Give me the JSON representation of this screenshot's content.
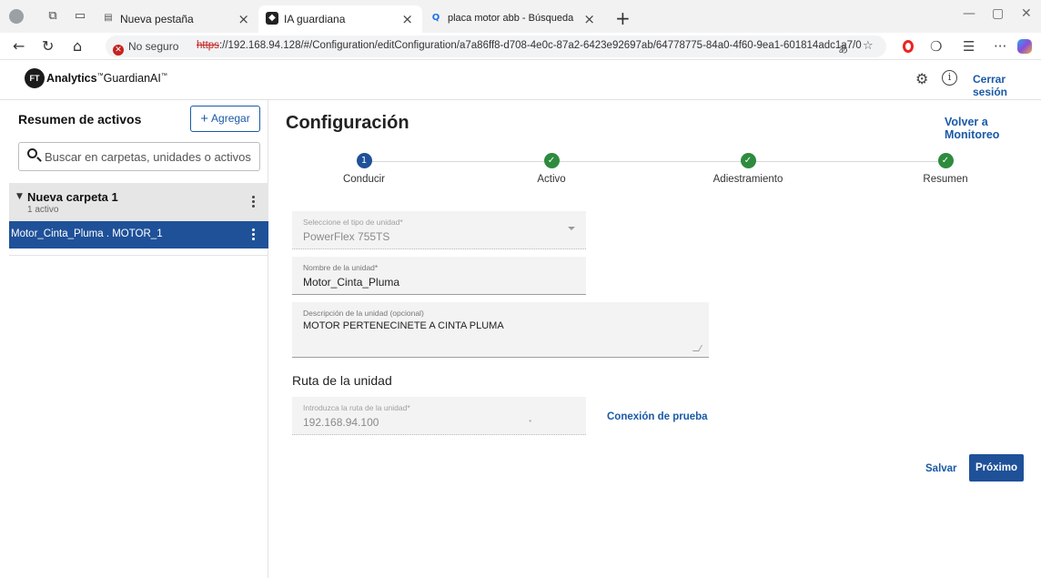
{
  "browser": {
    "tabs": [
      {
        "title": "Nueva pestaña",
        "active": false
      },
      {
        "title": "IA guardiana",
        "active": true
      },
      {
        "title": "placa motor abb - Búsqueda Imá",
        "active": false
      }
    ],
    "security_label": "No seguro",
    "url_scheme": "https",
    "url_rest": "://192.168.94.128/#/Configuration/editConfiguration/a7a86ff8-d708-4e0c-87a2-6423e92697ab/64778775-84a0-4f60-9ea1-601814adc1a7/0"
  },
  "header": {
    "logo_text": "FT",
    "brand_name": "Analytics",
    "brand_product": "GuardianAI",
    "logout_label": "Cerrar sesión"
  },
  "sidebar": {
    "title": "Resumen de activos",
    "add_label": "Agregar",
    "search_placeholder": "Buscar en carpetas, unidades o activos",
    "folder": {
      "name": "Nueva carpeta 1",
      "count_label": "1 activo"
    },
    "selected_asset": "Motor_Cinta_Pluma . MOTOR_1"
  },
  "main": {
    "title": "Configuración",
    "back_link": "Volver a Monitoreo",
    "steps": [
      {
        "number": "1",
        "label": "Conducir",
        "state": "current"
      },
      {
        "number": "",
        "label": "Activo",
        "state": "done"
      },
      {
        "number": "",
        "label": "Adiestramiento",
        "state": "done"
      },
      {
        "number": "",
        "label": "Resumen",
        "state": "done"
      }
    ],
    "unit_type": {
      "label": "Seleccione el tipo de unidad*",
      "value": "PowerFlex 755TS"
    },
    "unit_name": {
      "label": "Nombre de la unidad*",
      "value": "Motor_Cinta_Pluma"
    },
    "unit_description": {
      "label": "Descripción de la unidad (opcional)",
      "value": "MOTOR PERTENECINETE A CINTA PLUMA"
    },
    "route_section_title": "Ruta de la unidad",
    "unit_route": {
      "label": "Introduzca la ruta de la unidad*",
      "value": "192.168.94.100"
    },
    "test_connection_label": "Conexión de prueba",
    "save_label": "Salvar",
    "next_label": "Próximo"
  },
  "colors": {
    "accent": "#1a5aa6",
    "primary_button": "#1f5199",
    "step_current": "#1f5199",
    "step_done": "#2e8b3e",
    "not_secure": "#c5221f"
  }
}
